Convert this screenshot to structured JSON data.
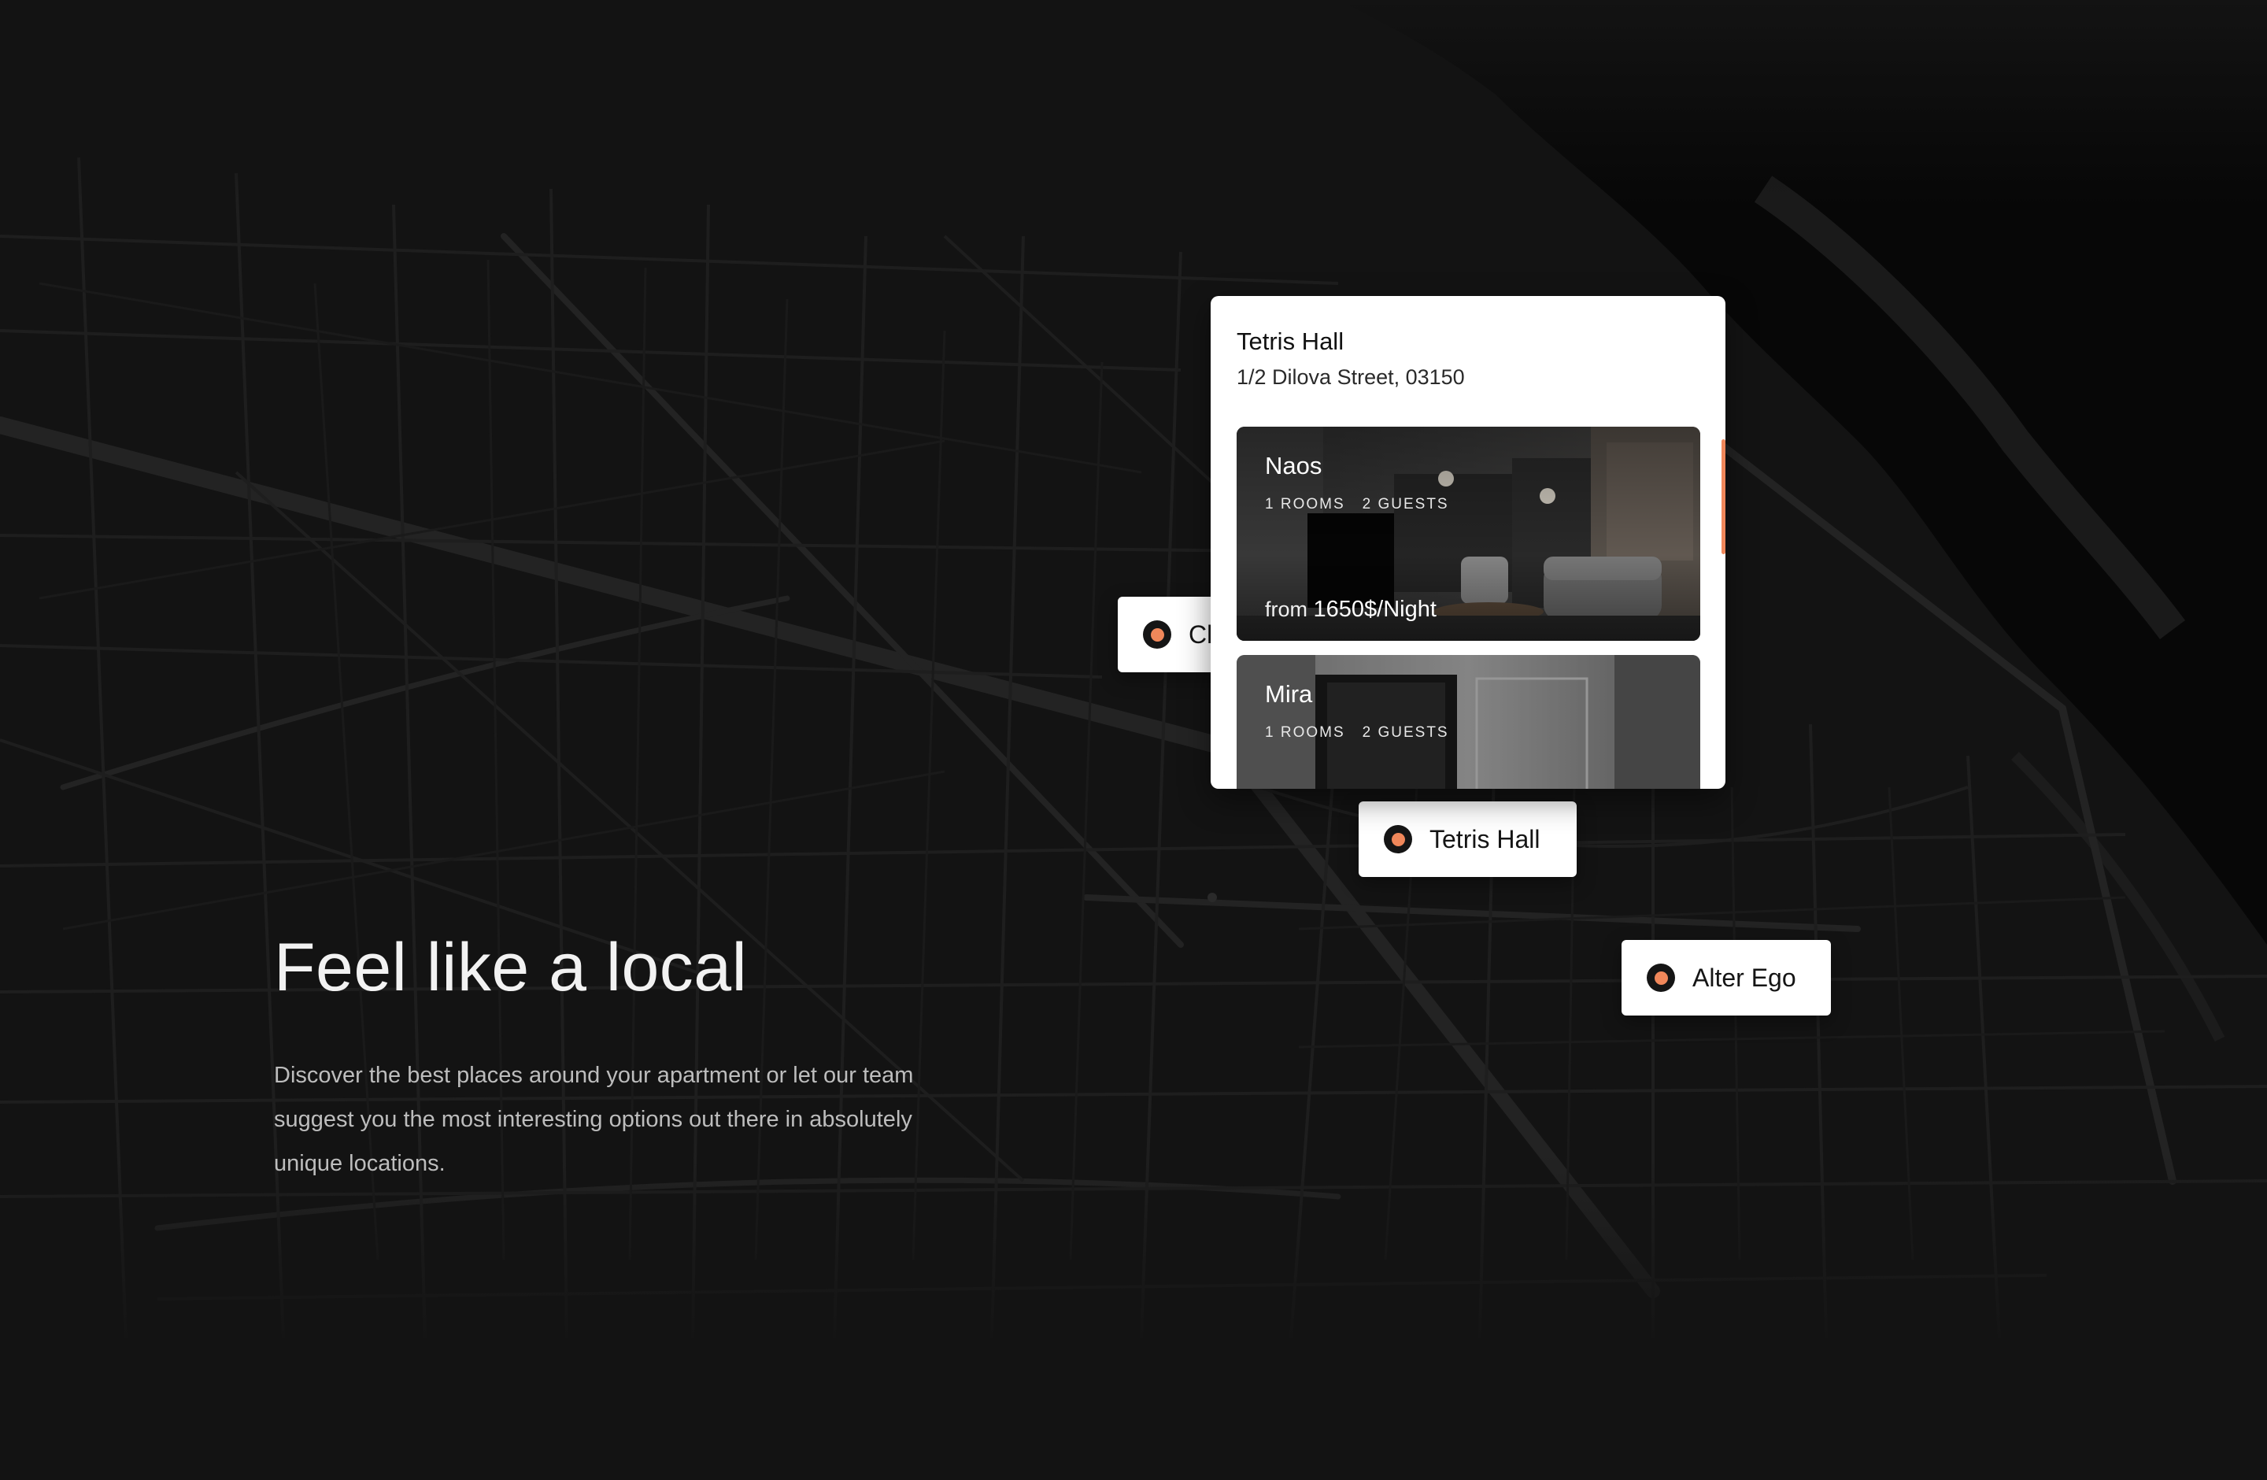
{
  "hero": {
    "title": "Feel like a local",
    "description": "Discover the best places around your apartment or let our team suggest you the most interesting options out there in absolutely unique locations."
  },
  "markers": [
    {
      "label": "Cl"
    },
    {
      "label": "Tetris Hall"
    },
    {
      "label": "Alter Ego"
    }
  ],
  "popup": {
    "title": "Tetris Hall",
    "address": "1/2 Dilova Street, 03150",
    "rooms": [
      {
        "name": "Naos",
        "rooms": "1 ROOMS",
        "guests": "2 GUESTS",
        "price_prefix": "from",
        "price": "1650$/Night"
      },
      {
        "name": "Mira",
        "rooms": "1 ROOMS",
        "guests": "2 GUESTS"
      }
    ]
  },
  "colors": {
    "background": "#131313",
    "accent": "#f0875a",
    "card": "#ffffff"
  },
  "icons": {
    "marker": "map-pin-dot-icon"
  }
}
